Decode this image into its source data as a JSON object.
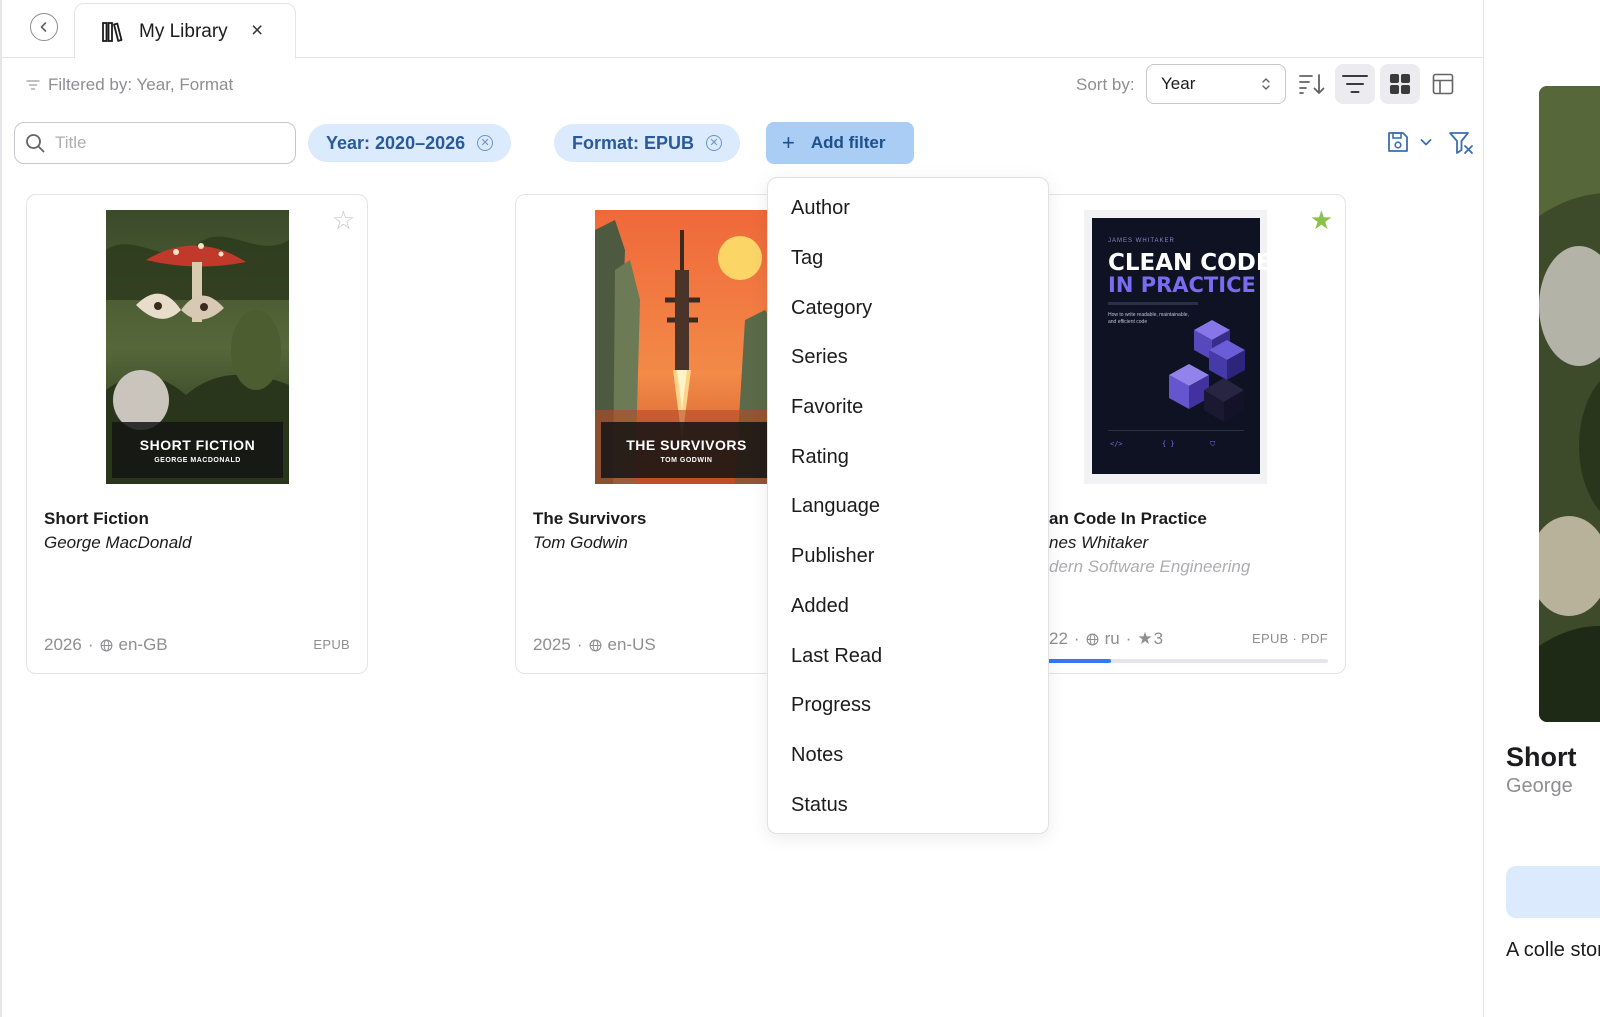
{
  "tab": {
    "title": "My Library",
    "close": "×"
  },
  "toolbar": {
    "filtered_label": "Filtered by: Year, Format",
    "sort_label": "Sort by:",
    "sort_value": "Year"
  },
  "filterbar": {
    "search_placeholder": "Title",
    "search_value": "",
    "chips": [
      {
        "label": "Year: 2020–2026"
      },
      {
        "label": "Format: EPUB"
      }
    ],
    "add_filter_label": "Add filter"
  },
  "books": [
    {
      "title": "Short Fiction",
      "author": "George MacDonald",
      "series": "",
      "year": "2026",
      "language": "en-GB",
      "rating": "",
      "formats": "EPUB",
      "favorite": false,
      "progress": null,
      "cover_title": "SHORT FICTION",
      "cover_author": "GEORGE MACDONALD"
    },
    {
      "title": "The Survivors",
      "author": "Tom Godwin",
      "series": "",
      "year": "2025",
      "language": "en-US",
      "rating": "",
      "formats": "",
      "favorite": false,
      "progress": null,
      "cover_title": "THE SURVIVORS",
      "cover_author": "TOM GODWIN"
    },
    {
      "title": "an Code In Practice",
      "author": "nes Whitaker",
      "series": "dern Software Engineering",
      "year": "22",
      "language": "ru",
      "rating": "3",
      "formats": "EPUB · PDF",
      "favorite": true,
      "progress": 0.29,
      "cover_kicker": "JAMES WHITAKER",
      "cover_title_line1": "CLEAN CODE",
      "cover_title_line2": "IN PRACTICE",
      "cover_subtitle": "How to write readable, maintainable, and efficient code"
    }
  ],
  "filter_menu": {
    "items": [
      "Author",
      "Tag",
      "Category",
      "Series",
      "Favorite",
      "Rating",
      "Language",
      "Publisher",
      "Added",
      "Last Read",
      "Progress",
      "Notes",
      "Status"
    ]
  },
  "detail": {
    "title": "Short",
    "author": "George",
    "description": "A colle stories"
  },
  "colors": {
    "accent": "#3478f6",
    "chip_bg": "#dbeafc",
    "chip_text": "#2a5a9a",
    "favorite_star": "#8bc34a"
  }
}
